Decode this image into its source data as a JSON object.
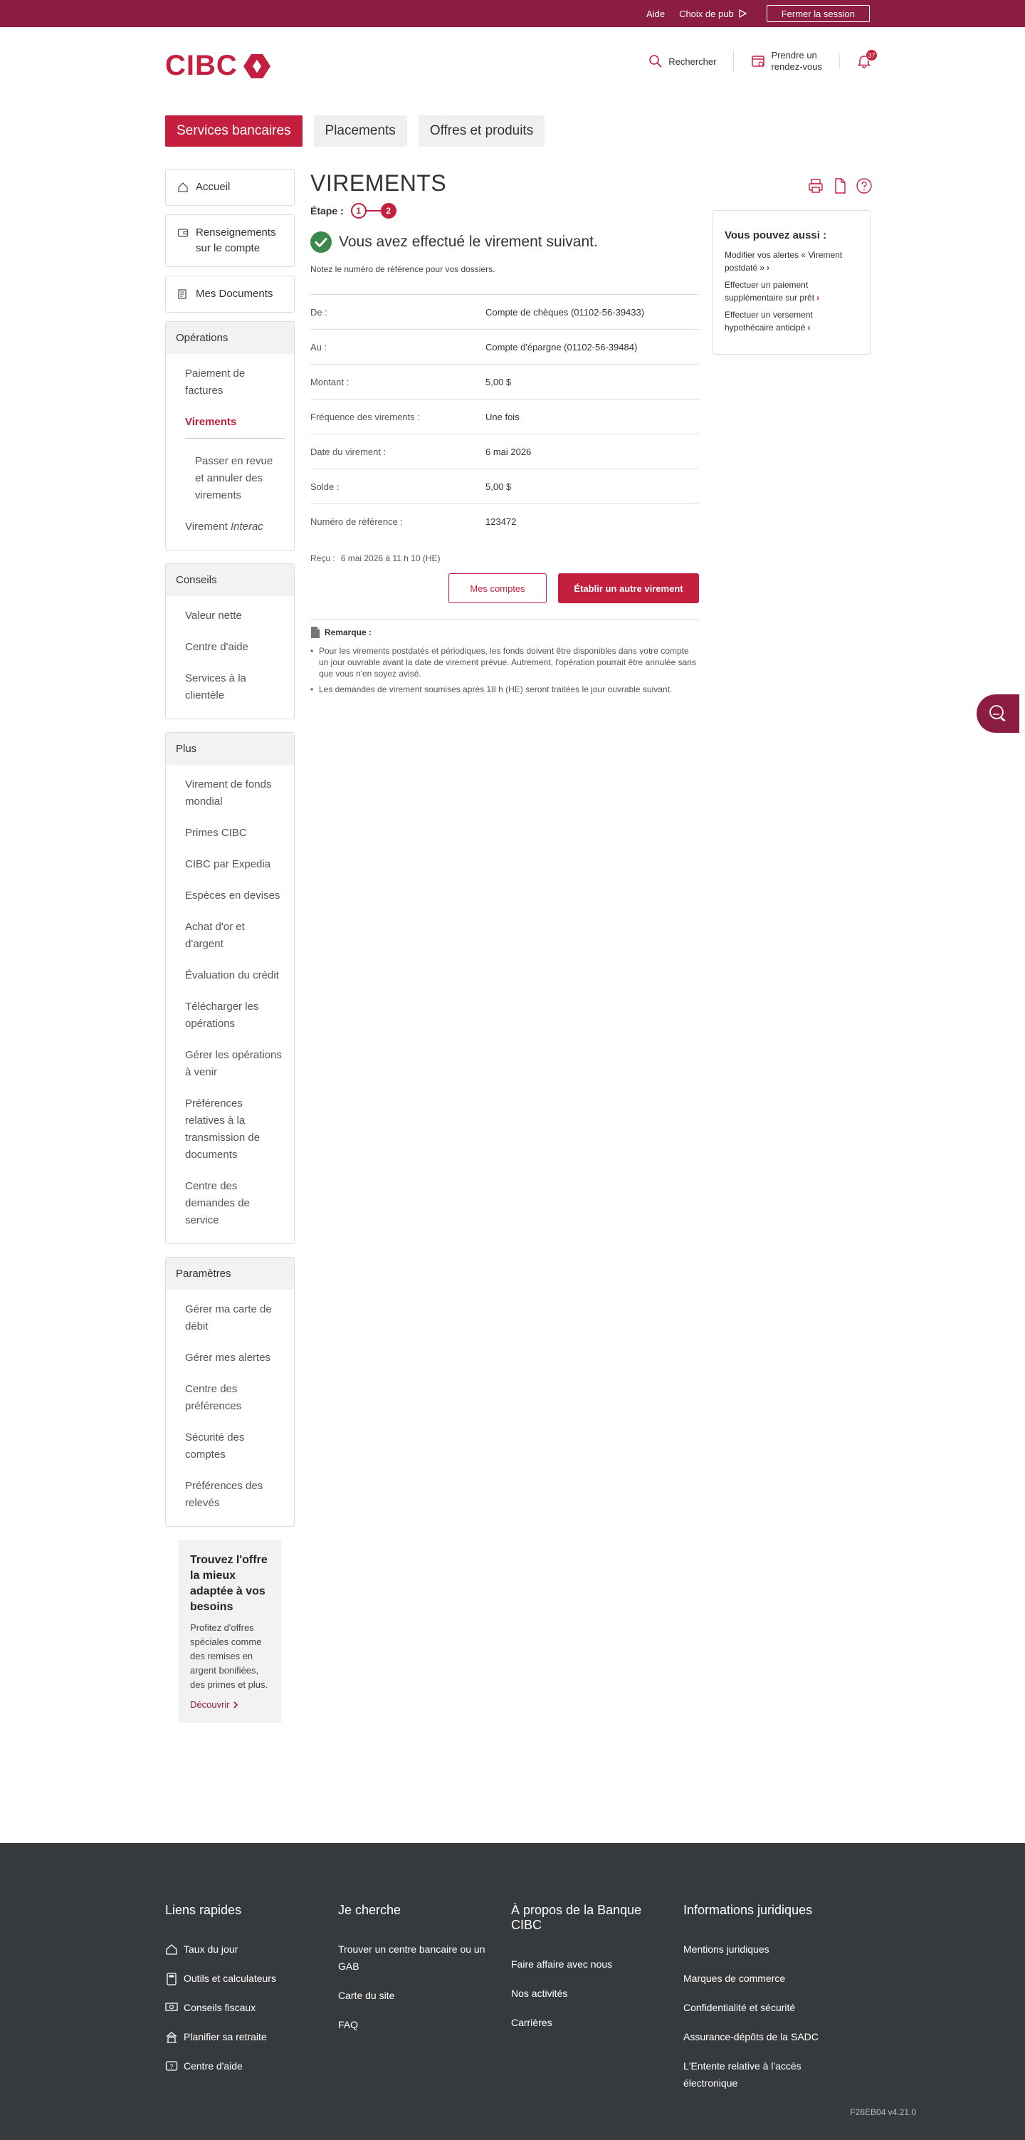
{
  "topbar": {
    "help": "Aide",
    "ad_choice": "Choix de pub",
    "logout": "Fermer la session"
  },
  "header": {
    "logo": "CIBC",
    "search": "Rechercher",
    "appointment_line1": "Prendre un",
    "appointment_line2": "rendez-vous",
    "notifications_count": "37"
  },
  "tabs": [
    {
      "label": "Services bancaires",
      "active": true
    },
    {
      "label": "Placements",
      "active": false
    },
    {
      "label": "Offres et produits",
      "active": false
    }
  ],
  "sidebar": {
    "home": "Accueil",
    "account_info": "Renseignements sur le compte",
    "documents": "Mes Documents",
    "operations": {
      "title": "Opérations",
      "items": [
        "Paiement de factures",
        "Virements",
        "Passer en revue et annuler des virements",
        "Virement",
        "Interac"
      ]
    },
    "conseils": {
      "title": "Conseils",
      "items": [
        "Valeur nette",
        "Centre d'aide",
        "Services à la clientèle"
      ]
    },
    "plus": {
      "title": "Plus",
      "items": [
        "Virement de fonds mondial",
        "Primes CIBC",
        "CIBC par Expedia",
        "Espèces en devises",
        "Achat d'or et d'argent",
        "Évaluation du crédit",
        "Télécharger les opérations",
        "Gérer les opérations à venir",
        "Préférences relatives à la transmission de documents",
        "Centre des demandes de service"
      ]
    },
    "parametres": {
      "title": "Paramètres",
      "items": [
        "Gérer ma carte de débit",
        "Gérer mes alertes",
        "Centre des préférences",
        "Sécurité des comptes",
        "Préférences des relevés"
      ]
    },
    "promo": {
      "title": "Trouvez l'offre la mieux adaptée à vos besoins",
      "body": "Profitez d'offres spéciales comme des remises en argent bonifiées, des primes et plus.",
      "link": "Découvrir"
    }
  },
  "main": {
    "title": "VIREMENTS",
    "step_label": "Étape :",
    "step1": "1",
    "step2": "2",
    "success": "Vous avez effectué le virement suivant.",
    "note": "Notez le numéro de référence pour vos dossiers.",
    "details": [
      {
        "label": "De :",
        "value": "Compte de chèques (01102-56-39433)"
      },
      {
        "label": "Au :",
        "value": "Compte d'épargne (01102-56-39484)"
      },
      {
        "label": "Montant :",
        "value": "5,00 $"
      },
      {
        "label": "Fréquence des virements :",
        "value": "Une fois"
      },
      {
        "label": "Date du virement :",
        "value": "6 mai 2026"
      },
      {
        "label": "Solde :",
        "value": "5,00 $"
      },
      {
        "label": "Numéro de référence :",
        "value": "123472"
      }
    ],
    "received_label": "Reçu :",
    "received_value": "6 mai 2026 à 11 h 10 (HE)",
    "btn_accounts": "Mes comptes",
    "btn_another": "Établir un autre virement",
    "remark_title": "Remarque :",
    "remarks": [
      "Pour les virements postdatés et périodiques, les fonds doivent être disponibles dans votre compte un jour ouvrable avant la date de virement prévue. Autrement, l'opération pourrait être annulée sans que vous n'en soyez avisé.",
      "Les demandes de virement soumises après 18 h (HE) seront traitées le jour ouvrable suivant."
    ]
  },
  "aside": {
    "title": "Vous pouvez aussi :",
    "links": [
      "Modifier vos alertes « Virement postdaté »",
      "Effectuer un paiement supplémentaire sur prêt",
      "Effectuer un versement hypothécaire anticipé"
    ]
  },
  "footer": {
    "col1": {
      "title": "Liens rapides",
      "links": [
        "Taux du jour",
        "Outils et calculateurs",
        "Conseils fiscaux",
        "Planifier sa retraite",
        "Centre d'aide"
      ]
    },
    "col2": {
      "title": "Je cherche",
      "links": [
        "Trouver un centre bancaire ou un GAB",
        "Carte du site",
        "FAQ"
      ]
    },
    "col3": {
      "title": "À propos de la Banque CIBC",
      "links": [
        "Faire affaire avec nous",
        "Nos activités",
        "Carrières"
      ]
    },
    "col4": {
      "title": "Informations juridiques",
      "links": [
        "Mentions juridiques",
        "Marques de commerce",
        "Confidentialité et sécurité",
        "Assurance-dépôts de la SADC",
        "L'Entente relative à l'accès électronique"
      ]
    },
    "version": "F26EB04 v4.21.0"
  },
  "colors": {
    "brand_red": "#c41f3e",
    "topbar": "#8b1d41",
    "footer_bg": "#373a3d",
    "success_green": "#3c8a4b"
  }
}
